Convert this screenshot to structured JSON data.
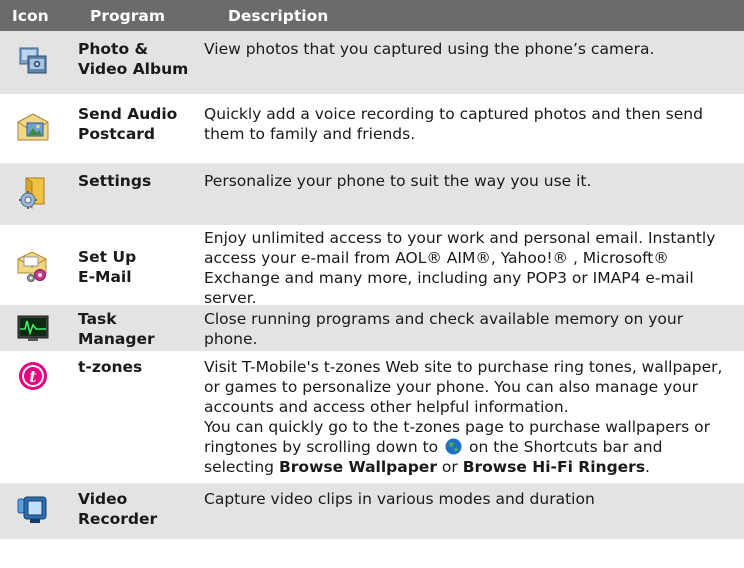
{
  "header": {
    "icon": "Icon",
    "program": "Program",
    "description": "Description"
  },
  "rows": [
    {
      "icon": "photo-album-icon",
      "program_line1": "Photo &",
      "program_line2": "Video Album",
      "description": "View photos that you captured using the phone’s camera."
    },
    {
      "icon": "audio-postcard-icon",
      "program_line1": "Send Audio",
      "program_line2": "Postcard",
      "description": "Quickly add a voice recording to captured photos and then send them to family and friends."
    },
    {
      "icon": "settings-folder-icon",
      "program_line1": "Settings",
      "program_line2": "",
      "description": "Personalize your phone to suit the way you use it."
    },
    {
      "icon": "email-setup-icon",
      "program_line1": "Set Up",
      "program_line2": "E-Mail",
      "description": "Enjoy unlimited access to your work and personal email. Instantly access your e-mail from AOL® AIM®, Yahoo!® , Microsoft® Exchange and many more, including any POP3 or IMAP4 e-mail server."
    },
    {
      "icon": "task-manager-icon",
      "program_line1": "Task",
      "program_line2": "Manager",
      "description": "Close running programs and check available memory on your phone."
    },
    {
      "icon": "t-zones-icon",
      "program_line1": "t-zones",
      "program_line2": "",
      "description": "Visit T-Mobile's t-zones Web site to purchase ring tones, wallpaper, or games to personalize your phone. You can also manage your accounts and access other helpful information.",
      "description2_a": "You can quickly go to the t-zones page to purchase wallpapers or ringtones by scrolling down to",
      "description2_b": "on the Shortcuts bar and selecting",
      "description2_bold1": "Browse Wallpaper",
      "description2_or": "or",
      "description2_bold2": "Browse Hi-Fi Ringers",
      "description2_end": "."
    },
    {
      "icon": "video-recorder-icon",
      "program_line1": "Video",
      "program_line2": "Recorder",
      "description": "Capture video clips in various modes and duration"
    }
  ],
  "colors": {
    "header_bg": "#6b6b6b",
    "alt_row": "#e3e3e3",
    "tzones_magenta": "#e6007e"
  }
}
